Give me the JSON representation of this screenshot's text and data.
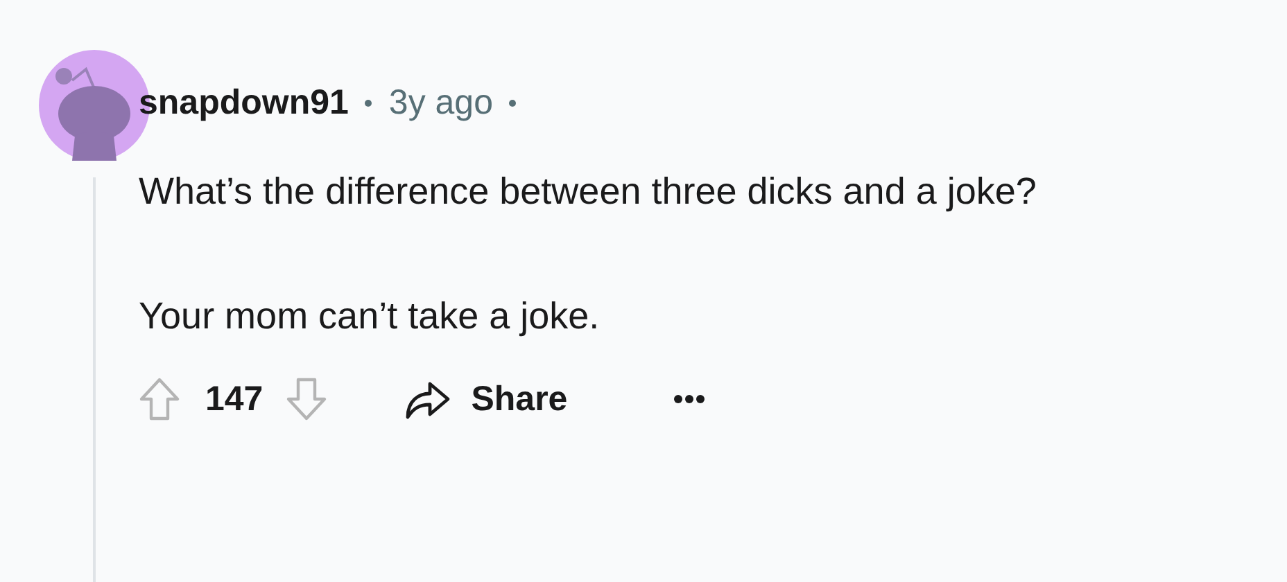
{
  "comment": {
    "author": "snapdown91",
    "time": "3y ago",
    "paragraphs": [
      "What’s the difference between three dicks and a joke?",
      "Your mom can’t take a joke."
    ],
    "score": "147",
    "share": "Share"
  }
}
